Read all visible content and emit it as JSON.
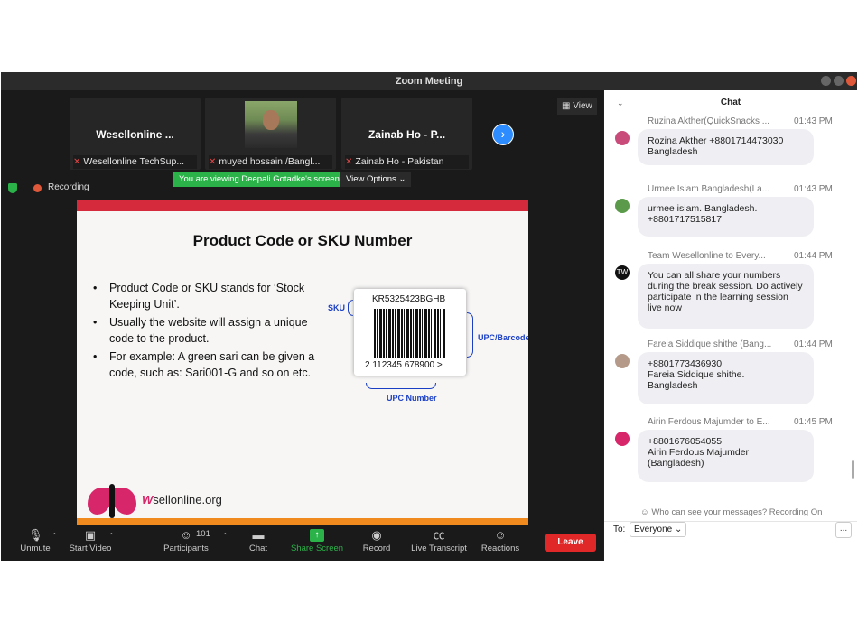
{
  "window": {
    "title": "Zoom Meeting"
  },
  "thumbnails": [
    {
      "name": "Wesellonline ...",
      "label": "Wesellonline TechSup..."
    },
    {
      "name": "",
      "label": "muyed hossain /Bangl..."
    },
    {
      "name": "Zainab Ho - P...",
      "label": "Zainab Ho - Pakistan"
    }
  ],
  "view_button": "View",
  "recording_label": "Recording",
  "viewing_banner": "You are viewing Deepali Gotadke's screen",
  "view_options": "View Options",
  "slide": {
    "title": "Product Code or SKU Number",
    "bullets": [
      "Product Code or SKU stands for ‘Stock Keeping Unit’.",
      "Usually the website will assign a unique code to the product.",
      " For example: A green sari can be given a code, such as: Sari001-G and so on etc."
    ],
    "barcode_top": "KR5325423BGHB",
    "barcode_number": "2  112345  678900  >",
    "sku_label": "SKU",
    "upc_barcode_label": "UPC/Barcode",
    "upc_number_label": "UPC Number",
    "logo_text_w": "W",
    "logo_text_rest": "sellonline.org"
  },
  "toolbar": {
    "unmute": "Unmute",
    "start_video": "Start Video",
    "participants": "Participants",
    "participants_count": "101",
    "chat": "Chat",
    "share_screen": "Share Screen",
    "record": "Record",
    "live_transcript": "Live Transcript",
    "reactions": "Reactions",
    "leave": "Leave"
  },
  "chat": {
    "title": "Chat",
    "messages": [
      {
        "sender": "Ruzina Akther(QuickSnacks ...",
        "time": "01:43 PM",
        "text": "Rozina Akther +8801714473030\nBangladesh",
        "avatar": ""
      },
      {
        "sender": "Urmee Islam Bangladesh(La...",
        "time": "01:43 PM",
        "text": "urmee islam. Bangladesh.\n+8801717515817",
        "avatar": ""
      },
      {
        "sender": "Team Wesellonline to Every...",
        "time": "01:44 PM",
        "text": "You can all share your numbers during the break session. Do actively participate in the learning session live now",
        "avatar": "TW"
      },
      {
        "sender": "Fareia Siddique shithe (Bang...",
        "time": "01:44 PM",
        "text": "+8801773436930\nFareia Siddique shithe.\nBangladesh",
        "avatar": ""
      },
      {
        "sender": "Airin Ferdous Majumder to E...",
        "time": "01:45 PM",
        "text": "+8801676054055\nAirin Ferdous Majumder\n(Bangladesh)",
        "avatar": ""
      }
    ],
    "who_can_see": "Who can see your messages? Recording On",
    "to_label": "To:",
    "recipient": "Everyone",
    "more": "..."
  }
}
